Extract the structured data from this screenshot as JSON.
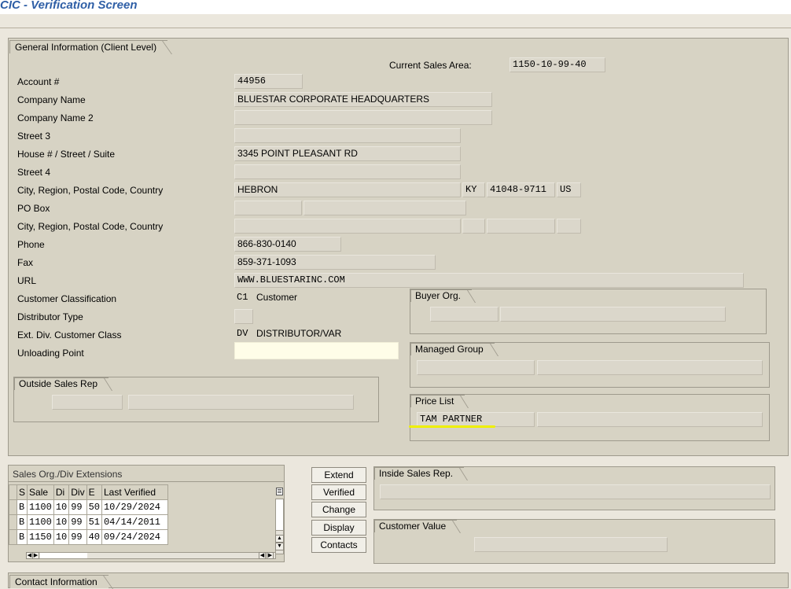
{
  "window": {
    "title": "CIC - Verification Screen"
  },
  "general": {
    "tab": "General Information (Client Level)",
    "current_sales_area_label": "Current Sales Area:",
    "current_sales_area": "1150-10-99-40",
    "rows": {
      "account_label": "Account #",
      "account": "44956",
      "company_label": "Company Name",
      "company": "BLUESTAR  CORPORATE HEADQUARTERS",
      "company2_label": "Company Name 2",
      "company2": "",
      "street3_label": "Street 3",
      "street3": "",
      "house_label": "House # / Street / Suite",
      "house": "3345 POINT PLEASANT RD",
      "street4_label": "Street 4",
      "street4": "",
      "city_label": "City, Region, Postal Code, Country",
      "city": "HEBRON",
      "region": "KY",
      "postal": "41048-9711",
      "country": "US",
      "pobox_label": "PO Box",
      "city2_label": "City, Region, Postal Code, Country",
      "phone_label": "Phone",
      "phone": "866-830-0140",
      "fax_label": "Fax",
      "fax": "859-371-1093",
      "url_label": "URL",
      "url": "WWW.BLUESTARINC.COM",
      "custclass_label": "Customer Classification",
      "custclass_code": "C1",
      "custclass": "Customer",
      "disttype_label": "Distributor Type",
      "extdiv_label": "Ext. Div. Customer Class",
      "extdiv_code": "DV",
      "extdiv": "DISTRIBUTOR/VAR",
      "unloading_label": "Unloading Point"
    },
    "buyer_org": "Buyer Org.",
    "managed_group": "Managed Group",
    "price_list": {
      "label": "Price List",
      "value": "TAM PARTNER"
    },
    "outside_sales_rep": "Outside Sales Rep"
  },
  "extensions": {
    "tab": "Sales Org./Div Extensions",
    "headers": [
      "S",
      "Sale",
      "Di",
      "Div",
      "E",
      "Last Verified"
    ],
    "rows": [
      [
        "B",
        "1100",
        "10",
        "99",
        "50",
        "10/29/2024"
      ],
      [
        "B",
        "1100",
        "10",
        "99",
        "51",
        "04/14/2011"
      ],
      [
        "B",
        "1150",
        "10",
        "99",
        "40",
        "09/24/2024"
      ]
    ]
  },
  "buttons": {
    "extend": "Extend",
    "verified": "Verified",
    "change": "Change",
    "display": "Display",
    "contacts": "Contacts"
  },
  "inside_sales_rep": "Inside Sales Rep.",
  "customer_value": "Customer Value",
  "contact_info": "Contact Information"
}
